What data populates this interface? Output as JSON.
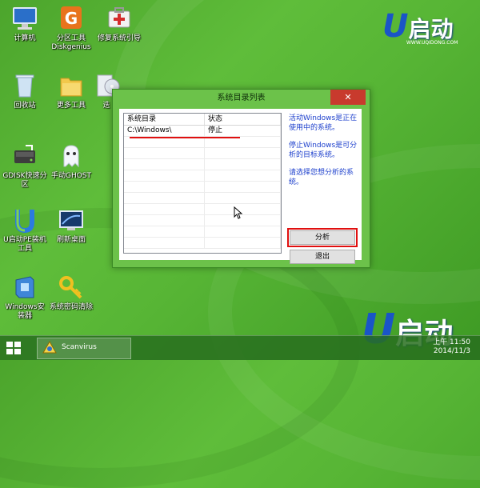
{
  "desktop": {
    "icons": [
      {
        "label": "计算机"
      },
      {
        "label": "分区工具\nDiskgenius"
      },
      {
        "label": "修复系统引导"
      },
      {
        "label": "回收站"
      },
      {
        "label": "更多工具"
      },
      {
        "label": "迭"
      },
      {
        "label": "GDISK快速分\n区"
      },
      {
        "label": "手动GHOST"
      },
      {
        "label": "U启动PE装机\n工具"
      },
      {
        "label": "刷新桌面"
      },
      {
        "label": "Windows安\n装器"
      },
      {
        "label": "系统密码清除"
      }
    ]
  },
  "brand": {
    "top_text": "启动",
    "top_url": "WWW.UQIDONG.COM",
    "bottom_text": "启动"
  },
  "dialog": {
    "title": "系统目录列表",
    "close_glyph": "✕",
    "columns": [
      "系统目录",
      "状态"
    ],
    "rows": [
      {
        "dir": "C:\\Windows\\",
        "status": "停止"
      }
    ],
    "info1": "活动Windows是正在使用中的系统。",
    "info2": "停止Windows是可分析的目标系统。",
    "info3": "请选择您想分析的系统。",
    "analyze_label": "分析",
    "exit_label": "退出"
  },
  "taskbar": {
    "task_label": "Scanvirus",
    "time": "上午 11:50",
    "date": "2014/11/3"
  },
  "colors": {
    "desktop_green": "#57b535",
    "highlight_red": "#e01010",
    "info_blue": "#1c3fcc",
    "brand_blue": "#1a55c7"
  }
}
